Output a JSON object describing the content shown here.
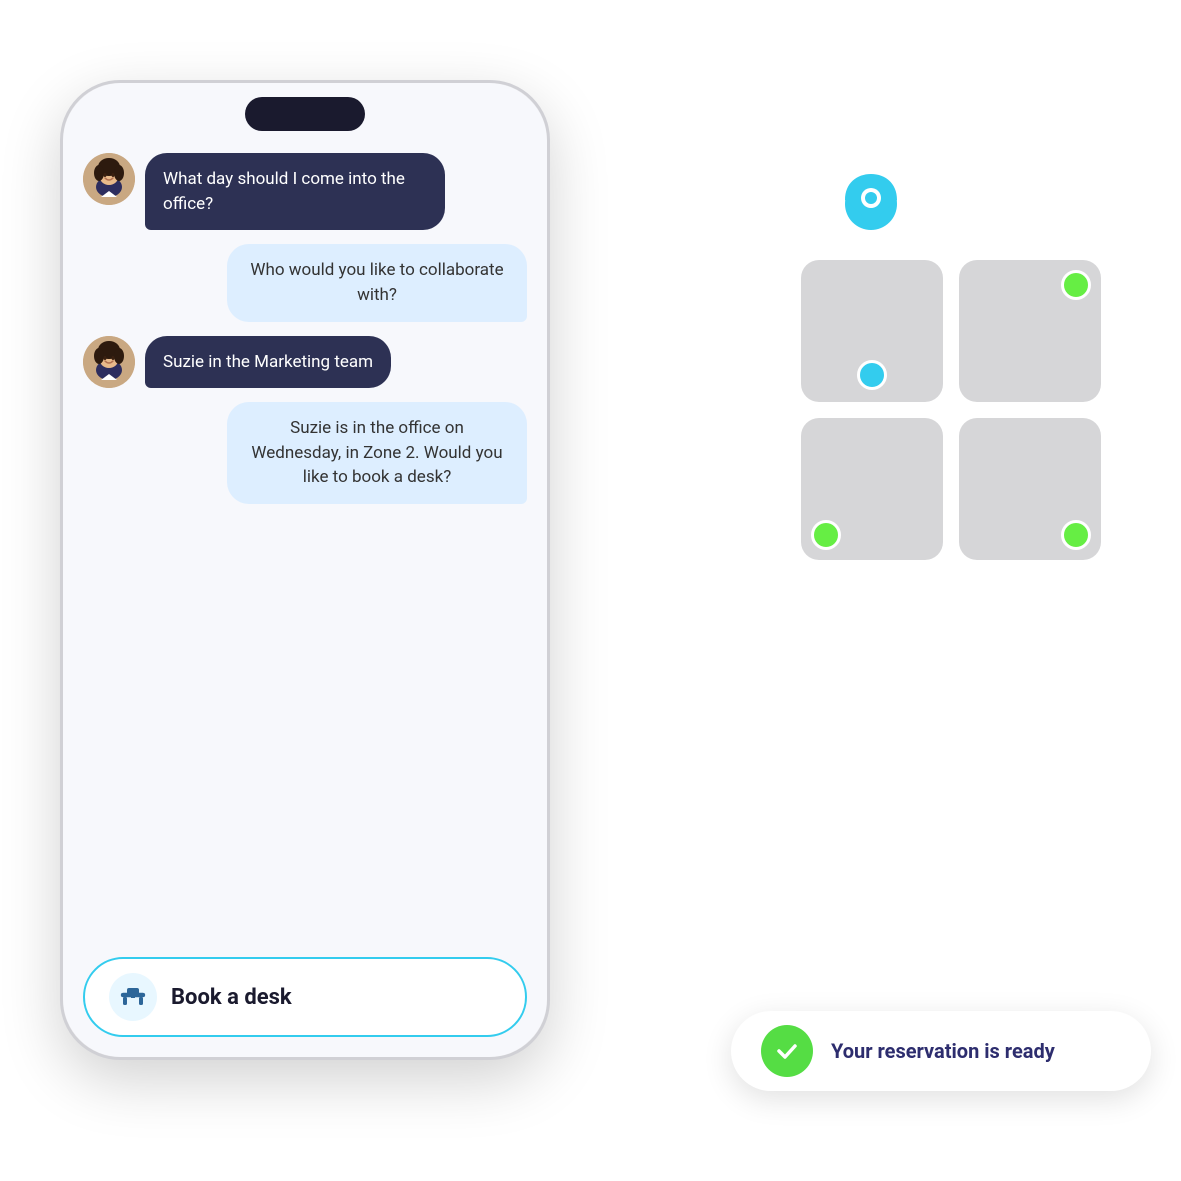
{
  "background_color": "#ffffff",
  "phone": {
    "chat": {
      "msg1": {
        "text": "What day should I come into the office?",
        "type": "user"
      },
      "msg2": {
        "text": "Who would you like to collaborate with?",
        "type": "bot"
      },
      "msg3": {
        "text": "Suzie in the Marketing team",
        "type": "user"
      },
      "msg4": {
        "text": "Suzie is in the office on Wednesday, in Zone 2. Would you like to book a desk?",
        "type": "bot"
      }
    },
    "book_button": {
      "label": "Book a desk"
    }
  },
  "desk_map": {
    "cells": [
      {
        "id": 1,
        "dot_color": "#33ccee",
        "selected": true
      },
      {
        "id": 2,
        "dot_color": "#66ee44",
        "selected": false
      },
      {
        "id": 3,
        "dot_color": "#66ee44",
        "selected": false
      },
      {
        "id": 4,
        "dot_color": "#66ee44",
        "selected": false
      }
    ]
  },
  "reservation": {
    "text": "Your reservation is ready",
    "check_color": "#55dd44"
  }
}
